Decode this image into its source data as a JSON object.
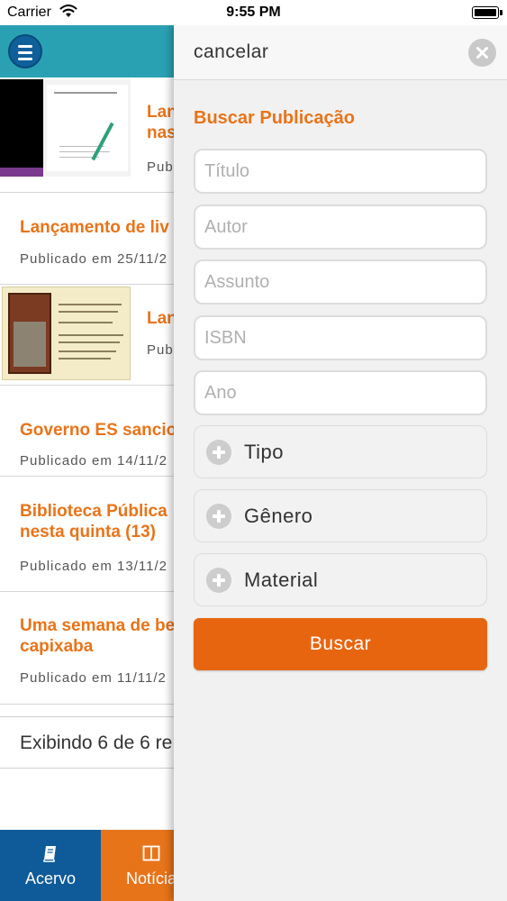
{
  "status_bar": {
    "carrier": "Carrier",
    "time": "9:55 PM"
  },
  "news": {
    "items": [
      {
        "title": "Lan",
        "title2": "nas",
        "meta": "Publ"
      },
      {
        "title": "Lançamento de liv",
        "meta": "Publicado em 25/11/2"
      },
      {
        "title": "Lan",
        "meta": "Pub"
      },
      {
        "title": "Governo ES sancio",
        "meta": "Publicado em 14/11/2"
      },
      {
        "title": "Biblioteca Pública",
        "title2": "nesta quinta (13)",
        "meta": "Publicado em 13/11/2"
      },
      {
        "title": "Uma semana de be",
        "title2": "capixaba",
        "meta": "Publicado em 11/11/2"
      }
    ],
    "showing": "Exibindo 6 de 6 re"
  },
  "tabs": [
    {
      "label": "Acervo",
      "icon": "book-icon",
      "color": "#0f5b99"
    },
    {
      "label": "Notícia",
      "icon": "newspaper-icon",
      "color": "#e8741a"
    }
  ],
  "drawer": {
    "cancel_label": "cancelar",
    "title": "Buscar Publicação",
    "fields": {
      "titulo": {
        "placeholder": "Título"
      },
      "autor": {
        "placeholder": "Autor"
      },
      "assunto": {
        "placeholder": "Assunto"
      },
      "isbn": {
        "placeholder": "ISBN"
      },
      "ano": {
        "placeholder": "Ano"
      }
    },
    "filters": [
      {
        "label": "Tipo"
      },
      {
        "label": "Gênero"
      },
      {
        "label": "Material"
      }
    ],
    "search_button": "Buscar"
  },
  "colors": {
    "accent": "#e8741a",
    "header": "#2aa1b3",
    "nav_blue": "#0f5b99",
    "button": "#e8650f"
  }
}
